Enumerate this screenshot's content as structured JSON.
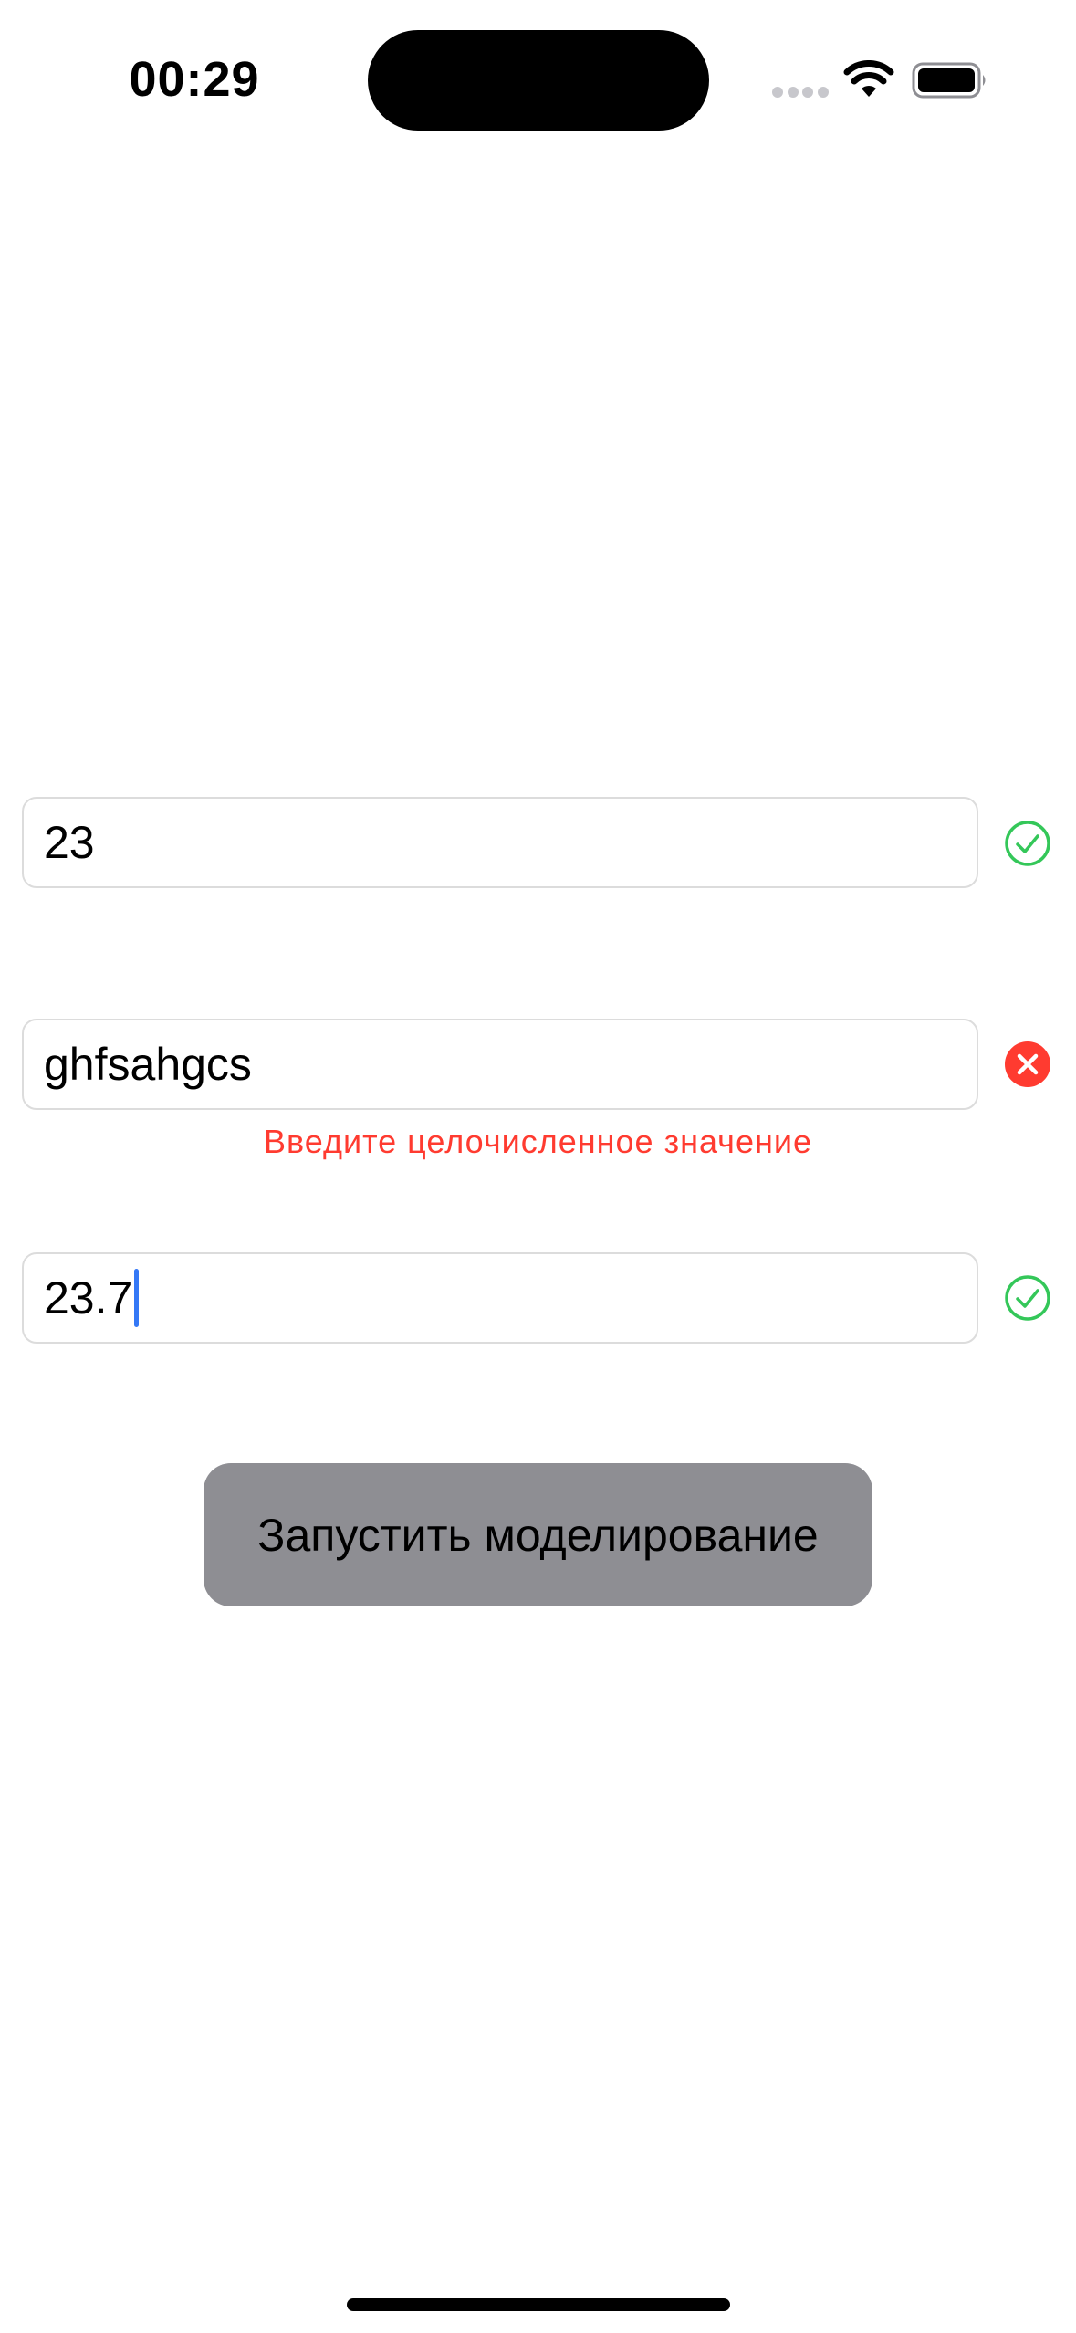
{
  "status_bar": {
    "time": "00:29",
    "icons": [
      "cellular-icon",
      "wifi-icon",
      "battery-icon"
    ]
  },
  "form": {
    "fields": [
      {
        "value": "23",
        "status": "valid",
        "status_icon": "checkmark-circle-icon"
      },
      {
        "value": "ghfsahgcs",
        "status": "invalid",
        "status_icon": "x-circle-icon",
        "error": "Введите целочисленное значение"
      },
      {
        "value": "23.7",
        "status": "valid",
        "status_icon": "checkmark-circle-icon",
        "focused": true
      }
    ]
  },
  "actions": {
    "run_label": "Запустить моделирование"
  },
  "colors": {
    "valid": "#34c759",
    "invalid": "#ff3b30",
    "caret": "#3478f6",
    "button_bg": "#8e8e93",
    "field_border": "#dcdcdc"
  }
}
